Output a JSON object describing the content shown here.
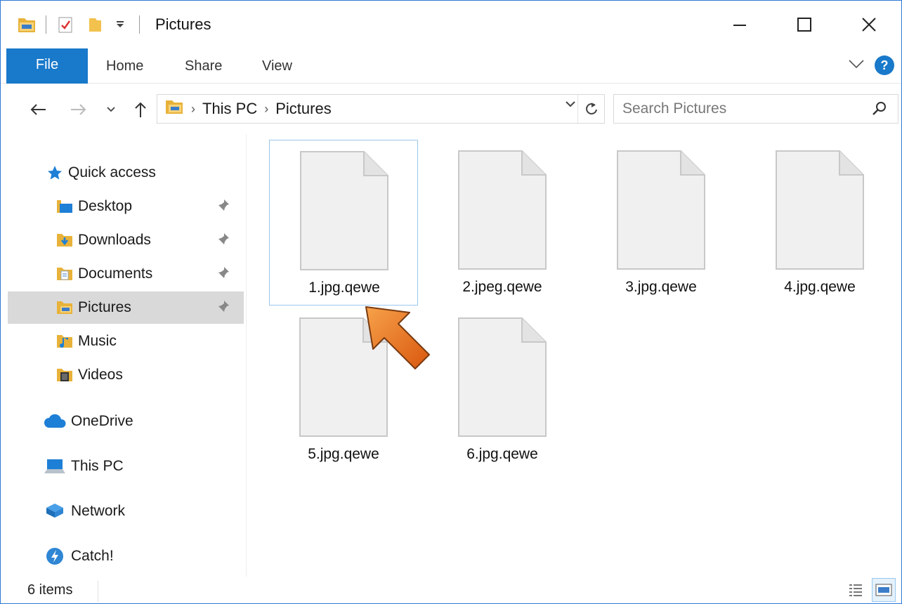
{
  "window": {
    "title": "Pictures"
  },
  "ribbon": {
    "tabs": [
      "File",
      "Home",
      "Share",
      "View"
    ]
  },
  "address": {
    "crumbs": [
      "This PC",
      "Pictures"
    ],
    "search_placeholder": "Search Pictures"
  },
  "navpane": {
    "items": [
      {
        "label": "Quick access",
        "icon": "star-icon"
      },
      {
        "label": "Desktop",
        "icon": "desktop-folder-icon",
        "pinned": true
      },
      {
        "label": "Downloads",
        "icon": "downloads-folder-icon",
        "pinned": true
      },
      {
        "label": "Documents",
        "icon": "documents-folder-icon",
        "pinned": true
      },
      {
        "label": "Pictures",
        "icon": "pictures-folder-icon",
        "pinned": true,
        "selected": true
      },
      {
        "label": "Music",
        "icon": "music-folder-icon"
      },
      {
        "label": "Videos",
        "icon": "videos-folder-icon"
      },
      {
        "label": "OneDrive",
        "icon": "cloud-icon"
      },
      {
        "label": "This PC",
        "icon": "computer-icon"
      },
      {
        "label": "Network",
        "icon": "network-icon"
      },
      {
        "label": "Catch!",
        "icon": "catch-icon"
      }
    ]
  },
  "files": [
    {
      "name": "1.jpg.qewe",
      "selected": true
    },
    {
      "name": "2.jpeg.qewe"
    },
    {
      "name": "3.jpg.qewe"
    },
    {
      "name": "4.jpg.qewe"
    },
    {
      "name": "5.jpg.qewe"
    },
    {
      "name": "6.jpg.qewe"
    }
  ],
  "status": {
    "item_count": "6 items"
  },
  "colors": {
    "accent": "#1979ca",
    "selected_nav": "#d9d9d9",
    "arrow": "#e8691c"
  }
}
